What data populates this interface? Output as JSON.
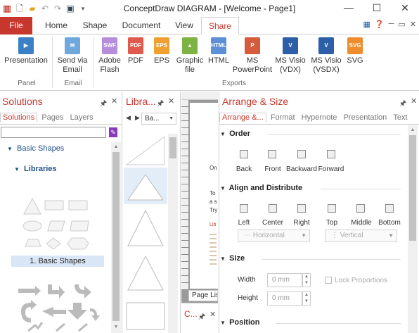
{
  "app_title": "ConceptDraw DIAGRAM - [Welcome - Page1]",
  "ribbon_tabs": [
    "File",
    "Home",
    "Shape",
    "Document",
    "View",
    "Share"
  ],
  "ribbon": {
    "buttons": [
      {
        "label": "Presentation",
        "icon": "presentation-icon"
      },
      {
        "label": "Send via\nEmail",
        "icon": "email-icon"
      },
      {
        "label": "Adobe\nFlash",
        "icon": "swf-icon",
        "badge": "SWF"
      },
      {
        "label": "PDF",
        "icon": "pdf-icon",
        "badge": "PDF"
      },
      {
        "label": "EPS",
        "icon": "eps-icon",
        "badge": "EPS"
      },
      {
        "label": "Graphic\nfile",
        "icon": "graphic-file-icon"
      },
      {
        "label": "HTML",
        "icon": "html-icon",
        "badge": "HTML"
      },
      {
        "label": "MS\nPowerPoint",
        "icon": "powerpoint-icon"
      },
      {
        "label": "MS Visio\n(VDX)",
        "icon": "visio-vdx-icon"
      },
      {
        "label": "MS Visio\n(VSDX)",
        "icon": "visio-vsdx-icon"
      },
      {
        "label": "SVG",
        "icon": "svg-icon",
        "badge": "SVG"
      }
    ],
    "groups": [
      "Panel",
      "Email",
      "Exports"
    ]
  },
  "solutions": {
    "title": "Solutions",
    "tabs": [
      "Solutions",
      "Pages",
      "Layers"
    ],
    "tree_root": "Basic Shapes",
    "libraries_label": "Libraries",
    "selected_library": "1. Basic Shapes"
  },
  "library": {
    "title": "Libra...",
    "combo": "Ba..."
  },
  "canvas": {
    "snippets": [
      "On",
      "To",
      "a s",
      "Try",
      "Lib"
    ],
    "page_list_tab": "Page Lis",
    "bottom_panel_title": "C..."
  },
  "arrange": {
    "title": "Arrange & Size",
    "tabs": [
      "Arrange &...",
      "Format",
      "Hypernote",
      "Presentation",
      "Text"
    ],
    "order": {
      "title": "Order",
      "buttons": [
        "Back",
        "Front",
        "Backward",
        "Forward"
      ]
    },
    "align": {
      "title": "Align and Distribute",
      "buttons": [
        "Left",
        "Center",
        "Right",
        "Top",
        "Middle",
        "Bottom"
      ],
      "horizontal": "Horizontal",
      "vertical": "Vertical"
    },
    "size": {
      "title": "Size",
      "width_label": "Width",
      "width_value": "0 mm",
      "height_label": "Height",
      "height_value": "0 mm",
      "lock": "Lock Proportions"
    },
    "position": {
      "title": "Position"
    }
  }
}
